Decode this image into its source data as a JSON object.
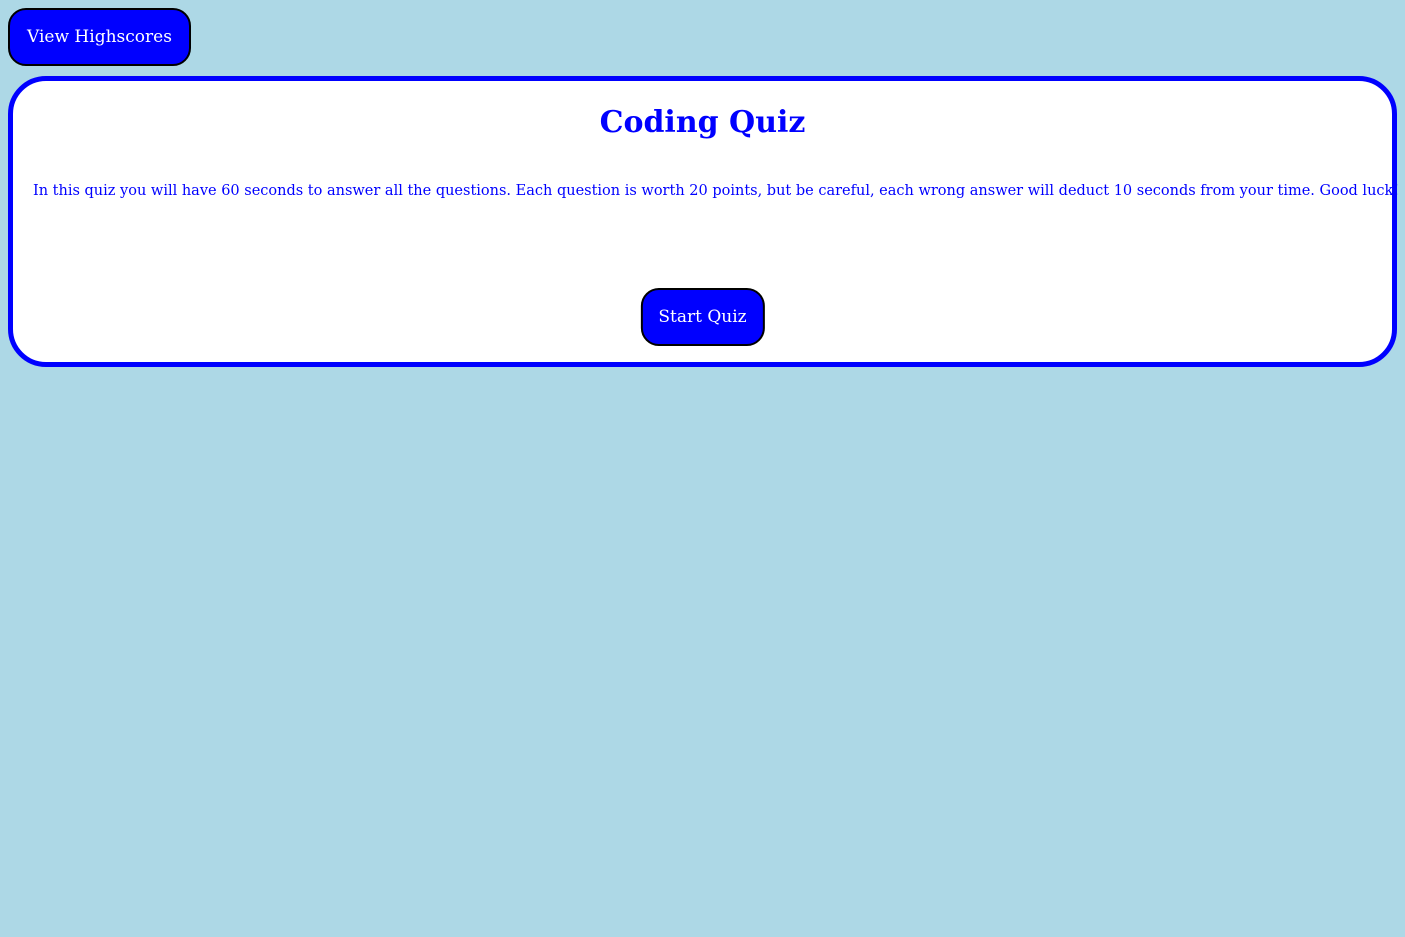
{
  "header": {
    "highscores_label": "View Highscores"
  },
  "quiz": {
    "title": "Coding Quiz",
    "description": "In this quiz you will have 60 seconds to answer all the questions. Each question is worth 20 points, but be careful, each wrong answer will deduct 10 seconds from your time. Good luck!",
    "start_label": "Start Quiz"
  },
  "colors": {
    "background": "#add8e6",
    "accent": "#0000ff",
    "card": "#ffffff"
  }
}
